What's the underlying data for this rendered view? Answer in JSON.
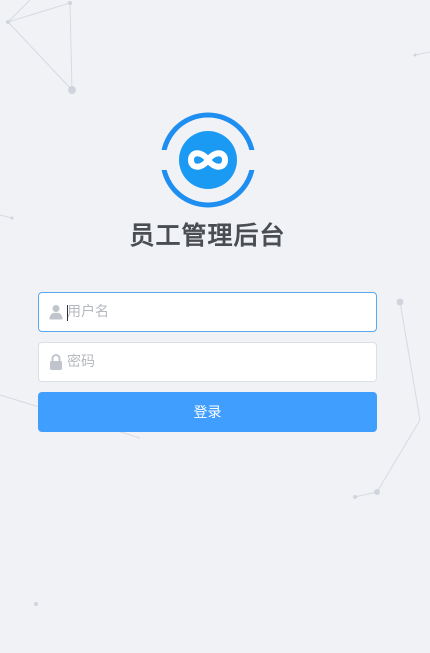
{
  "app": {
    "title": "员工管理后台"
  },
  "login": {
    "username": {
      "placeholder": "用户名",
      "value": "",
      "icon": "user-icon"
    },
    "password": {
      "placeholder": "密码",
      "value": "",
      "icon": "lock-icon"
    },
    "submit_label": "登录"
  },
  "colors": {
    "background": "#f0f2f6",
    "primary": "#409eff",
    "logo_blue": "#1e8ff0",
    "title": "#4a4d52",
    "input_border": "#dcdfe6",
    "input_focus_border": "#5aa8ee",
    "placeholder": "#b5b8bf"
  }
}
